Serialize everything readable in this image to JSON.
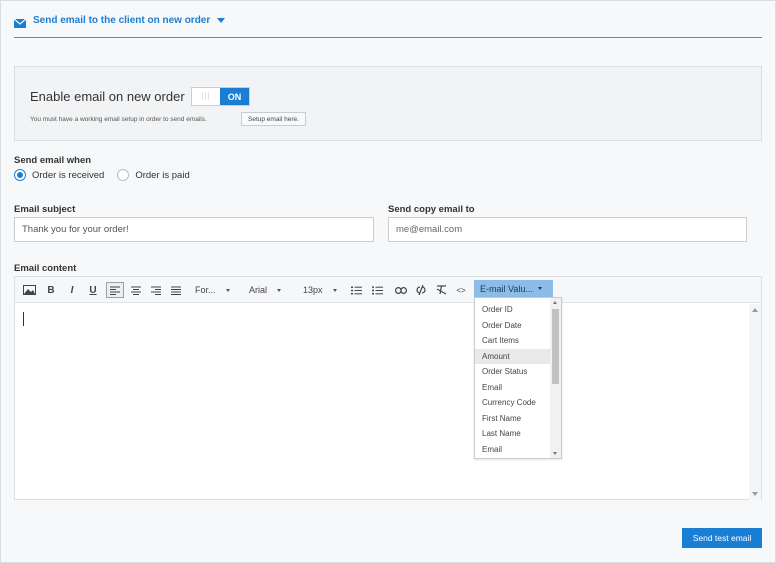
{
  "header": {
    "title": "Send email to the client on new order",
    "icon": "envelope-icon",
    "accent_color": "#1a7fd4"
  },
  "enable": {
    "label": "Enable email on new order",
    "toggle_state": "ON",
    "note": "You must have a working email setup in order to send emails.",
    "setup_button": "Setup email here."
  },
  "send_when": {
    "label": "Send email when",
    "options": [
      {
        "label": "Order is received",
        "checked": true
      },
      {
        "label": "Order is paid",
        "checked": false
      }
    ]
  },
  "subject": {
    "label": "Email subject",
    "value": "Thank you for your order!"
  },
  "copy_email": {
    "label": "Send copy email to",
    "placeholder": "me@email.com"
  },
  "content": {
    "label": "Email content",
    "toolbar": {
      "format": "For...",
      "font": "Arial",
      "size": "13px",
      "email_values": "E-mail Valu..."
    },
    "dropdown_items": [
      "Order ID",
      "Order Date",
      "Cart Items",
      "Amount",
      "Order Status",
      "Email",
      "Currency Code",
      "First Name",
      "Last Name",
      "Email"
    ],
    "highlighted_item": "Amount"
  },
  "actions": {
    "send_test": "Send test email"
  }
}
